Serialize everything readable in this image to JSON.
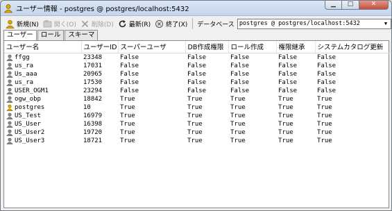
{
  "window": {
    "title": "ユーザー情報 - postgres @ postgres/localhost:5432",
    "buttons": {
      "minimize": "▁",
      "maximize": "□",
      "close": "✕"
    }
  },
  "toolbar": {
    "new_label": "新規(N)",
    "open_label": "開く(O)",
    "delete_label": "削除(D)",
    "refresh_label": "最新(R)",
    "exit_label": "終了(X)",
    "database_label": "データベース",
    "database_value": "postgres @ postgres/localhost:5432"
  },
  "tabs": [
    {
      "label": "ユーザー",
      "active": true
    },
    {
      "label": "ロール",
      "active": false
    },
    {
      "label": "スキーマ",
      "active": false
    }
  ],
  "table": {
    "columns": [
      "ユーザー名",
      "ユーザーID",
      "スーパーユーザ",
      "DB作成権限",
      "ロール作成",
      "権限継承",
      "システムカタログ更新"
    ],
    "rows": [
      {
        "name": "ffgg",
        "id": "23348",
        "super": "False",
        "createdb": "False",
        "createrole": "False",
        "inherit": "False",
        "catupd": "False",
        "icon": "user-icon"
      },
      {
        "name": "us_ra",
        "id": "17031",
        "super": "False",
        "createdb": "False",
        "createrole": "False",
        "inherit": "False",
        "catupd": "False",
        "icon": "user-icon"
      },
      {
        "name": "Us_aaa",
        "id": "20965",
        "super": "False",
        "createdb": "False",
        "createrole": "False",
        "inherit": "False",
        "catupd": "False",
        "icon": "user-icon"
      },
      {
        "name": "us_ra",
        "id": "17530",
        "super": "False",
        "createdb": "False",
        "createrole": "False",
        "inherit": "False",
        "catupd": "False",
        "icon": "user-icon"
      },
      {
        "name": "USER_OGM1",
        "id": "23294",
        "super": "False",
        "createdb": "False",
        "createrole": "False",
        "inherit": "False",
        "catupd": "False",
        "icon": "user-icon"
      },
      {
        "name": "ogw_obp",
        "id": "18842",
        "super": "True",
        "createdb": "True",
        "createrole": "True",
        "inherit": "True",
        "catupd": "True",
        "icon": "user-icon"
      },
      {
        "name": "postgres",
        "id": "10",
        "super": "True",
        "createdb": "True",
        "createrole": "True",
        "inherit": "True",
        "catupd": "True",
        "icon": "superuser-icon"
      },
      {
        "name": "US_Test",
        "id": "16979",
        "super": "True",
        "createdb": "True",
        "createrole": "True",
        "inherit": "True",
        "catupd": "True",
        "icon": "user-icon"
      },
      {
        "name": "US_User",
        "id": "16398",
        "super": "True",
        "createdb": "True",
        "createrole": "True",
        "inherit": "True",
        "catupd": "True",
        "icon": "user-icon"
      },
      {
        "name": "US_User2",
        "id": "19720",
        "super": "True",
        "createdb": "True",
        "createrole": "True",
        "inherit": "True",
        "catupd": "True",
        "icon": "user-icon"
      },
      {
        "name": "US_User3",
        "id": "18721",
        "super": "True",
        "createdb": "True",
        "createrole": "True",
        "inherit": "True",
        "catupd": "True",
        "icon": "user-icon"
      }
    ]
  },
  "colors": {
    "superuser_icon": "#e0a800",
    "user_icon": "#8a8a8a"
  }
}
